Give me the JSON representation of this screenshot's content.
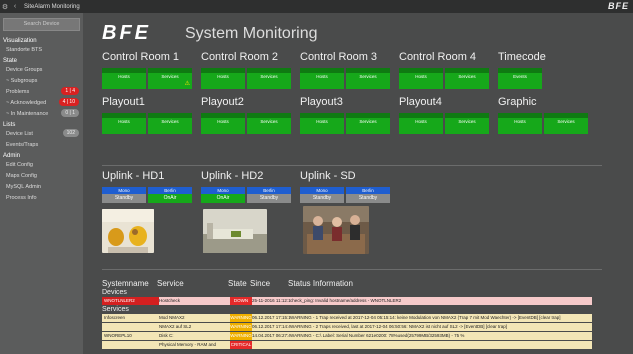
{
  "topbar": {
    "app_title": "SiteAlarm Monitoring",
    "brand": "BFE"
  },
  "sidebar": {
    "search_placeholder": "Search Device",
    "sections": [
      {
        "title": "Visualization",
        "items": [
          {
            "label": "Standorte BTS",
            "badge": null
          }
        ]
      },
      {
        "title": "State",
        "items": [
          {
            "label": "Device Groups",
            "badge": null
          },
          {
            "label": "~ Subgroups",
            "badge": null
          },
          {
            "label": "Problems",
            "badge": "1 | 4",
            "badge_type": "red"
          },
          {
            "label": "~ Acknowledged",
            "badge": "4 | 10",
            "badge_type": "red"
          },
          {
            "label": "~ In Maintenance",
            "badge": "0 | 1",
            "badge_type": "grey"
          }
        ]
      },
      {
        "title": "Lists",
        "items": [
          {
            "label": "Device List",
            "badge": "102",
            "badge_type": "grey"
          },
          {
            "label": "Events/Traps",
            "badge": null
          }
        ]
      },
      {
        "title": "Admin",
        "items": [
          {
            "label": "Edit Config",
            "badge": null
          },
          {
            "label": "Maps Config",
            "badge": null
          },
          {
            "label": "MySQL Admin",
            "badge": null
          },
          {
            "label": "Process Info",
            "badge": null
          }
        ]
      }
    ]
  },
  "main": {
    "logo": "BFE",
    "title": "System Monitoring",
    "rooms": [
      {
        "name": "Control Room 1",
        "buttons": [
          "Hosts",
          "Services"
        ],
        "warn_icon": true
      },
      {
        "name": "Control Room 2",
        "buttons": [
          "Hosts",
          "Services"
        ]
      },
      {
        "name": "Control Room 3",
        "buttons": [
          "Hosts",
          "Services"
        ]
      },
      {
        "name": "Control Room 4",
        "buttons": [
          "Hosts",
          "Services"
        ]
      },
      {
        "name": "Timecode",
        "buttons": [
          "Events"
        ]
      }
    ],
    "playouts": [
      {
        "name": "Playout1",
        "buttons": [
          "Hosts",
          "Services"
        ]
      },
      {
        "name": "Playout2",
        "buttons": [
          "Hosts",
          "Services"
        ]
      },
      {
        "name": "Playout3",
        "buttons": [
          "Hosts",
          "Services"
        ]
      },
      {
        "name": "Playout4",
        "buttons": [
          "Hosts",
          "Services"
        ]
      },
      {
        "name": "Graphic",
        "buttons": [
          "Hosts",
          "Services"
        ]
      }
    ],
    "uplinks": [
      {
        "name": "Uplink - HD1",
        "left_label": "Mono",
        "right_label": "Berlin",
        "left_state": "Standby",
        "right_state": "OnAir"
      },
      {
        "name": "Uplink - HD2",
        "left_label": "Mono",
        "right_label": "Berlin",
        "left_state": "OnAir",
        "right_state": "Standby"
      },
      {
        "name": "Uplink - SD",
        "left_label": "Mono",
        "right_label": "Berlin",
        "left_state": "Standby",
        "right_state": "Standby"
      }
    ],
    "table": {
      "headers": [
        "Systemname",
        "Service",
        "State",
        "Since",
        "Status Information"
      ],
      "devices_label": "Devices",
      "services_label": "Services",
      "devices": [
        {
          "name": "WNOTLNLER2",
          "service": "Hostcheck",
          "state": "DOWN",
          "since": "25-11-2016 11:12:15",
          "info": "check_ping: Invalid hostname/address - WNOTLNLER2"
        }
      ],
      "services": [
        {
          "name": "Infoscreen",
          "service": "Mod NMAX2",
          "state": "WARNING",
          "since": "06.12.2017 17:15:11",
          "info": "WARNING - 1 Trap received at 2017-12-04 05:15:14: keine Modulation von NMAX2 (Trap 7 mit Mod Waechter) -> [EventDB] [clear trap]"
        },
        {
          "name": "",
          "service": "NMAX2 auf SL2",
          "state": "WARNING",
          "since": "06.12.2017 17:14:44",
          "info": "WARNING - 2 Traps received, last at 2017-12-04 06:50:56: NMAX2 ist nicht auf SL2 -> [EventDB] [clear trap]"
        },
        {
          "name": "WNOREPL10",
          "service": "Disk C:",
          "state": "WARNING",
          "since": "14.04.2017 06:27:49",
          "info": "WARNING - C:\\ Label: Serial Number 621e0200: 78%used(25799MB/32593MB) - 75 %"
        },
        {
          "name": "",
          "service": "Physical Memory - RAM and",
          "state": "CRITICAL",
          "since": "",
          "info": ""
        }
      ]
    }
  }
}
